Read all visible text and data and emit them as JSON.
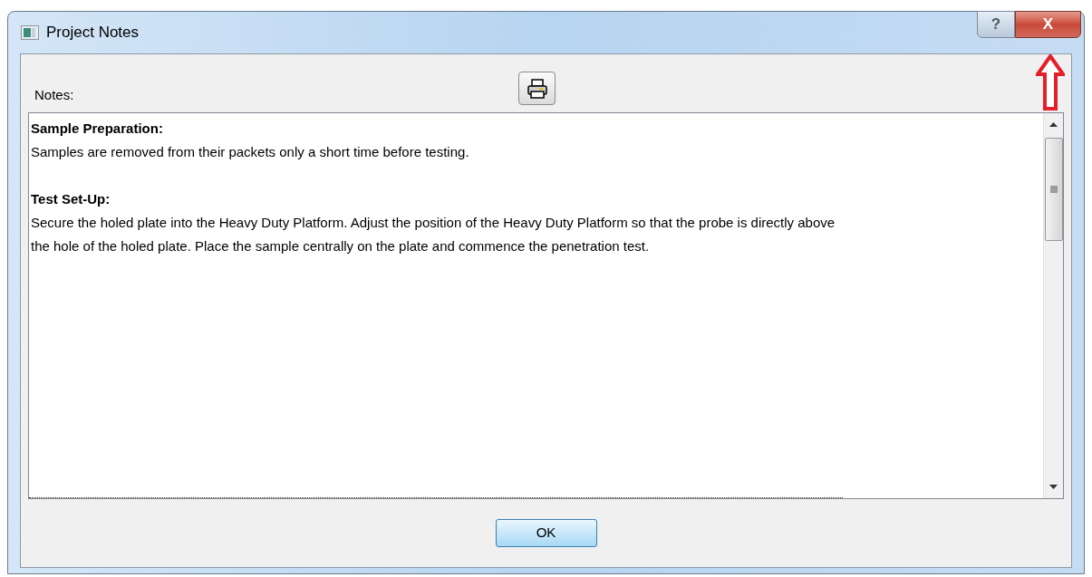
{
  "window": {
    "title": "Project Notes",
    "help_button": "?",
    "close_button": "X"
  },
  "notes": {
    "label": "Notes:",
    "sections": [
      {
        "heading": "Sample Preparation:",
        "body": "Samples are removed from their packets only a short time before testing."
      },
      {
        "heading": "Test Set-Up:",
        "body": "Secure the holed plate into the Heavy Duty Platform. Adjust the position of the Heavy Duty Platform so that the probe is directly above the hole of the holed plate.  Place the sample centrally on the plate and commence the penetration test."
      }
    ]
  },
  "buttons": [
    "OK"
  ]
}
